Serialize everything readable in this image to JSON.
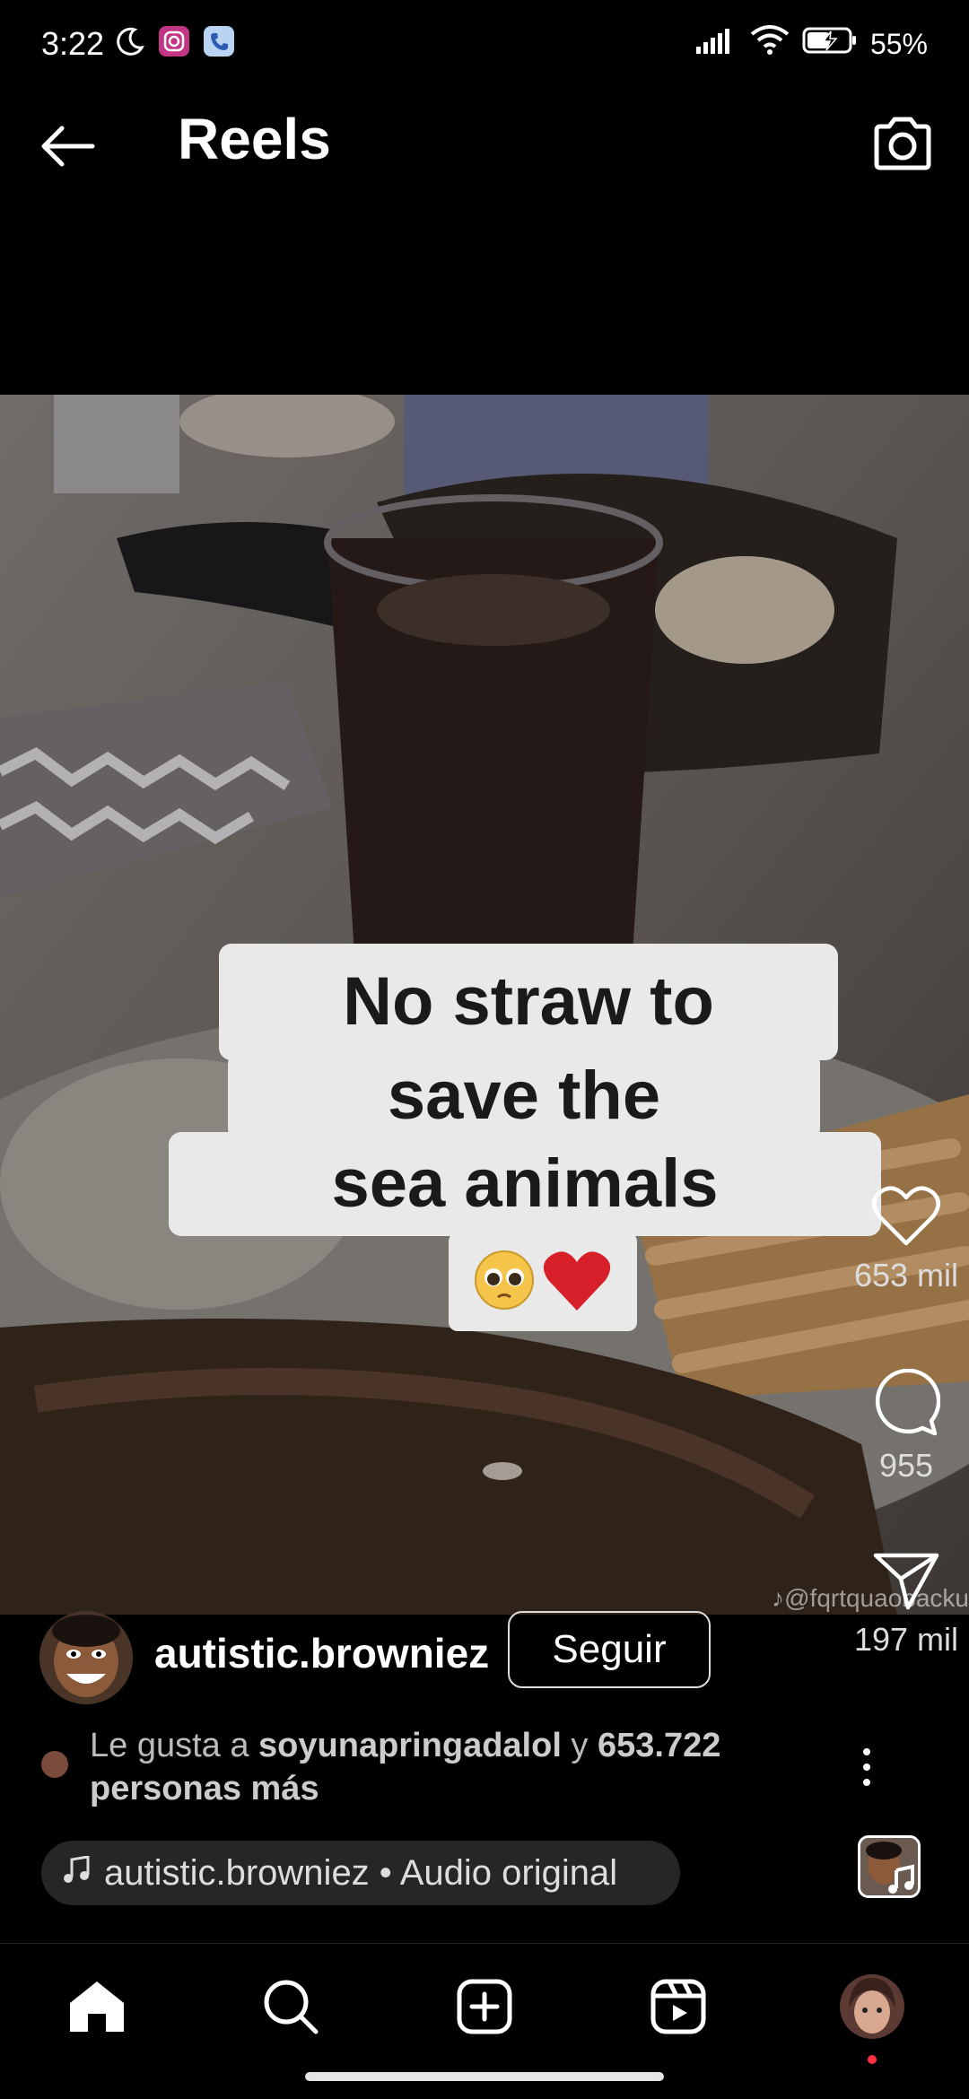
{
  "status_bar": {
    "time": "3:22",
    "battery": "55%",
    "icons": [
      "moon-icon",
      "instagram-icon",
      "phone-icon",
      "signal-icon",
      "wifi-icon",
      "battery-icon"
    ]
  },
  "header": {
    "title": "Reels",
    "back_icon": "arrow-left-icon",
    "camera_icon": "camera-icon"
  },
  "video": {
    "caption_lines": [
      "No straw to",
      "save the",
      "sea animals"
    ],
    "caption_emojis": "🥺❤️",
    "watermark": "♪@fqrtquaobacku"
  },
  "actions": {
    "likes": "653 mil",
    "comments": "955",
    "shares": "197 mil"
  },
  "user": {
    "username": "autistic.browniez",
    "follow_label": "Seguir"
  },
  "likes_info": {
    "prefix": "Le gusta a ",
    "liker": "soyunapringadalol",
    "connector": " y ",
    "count_text": "653.722 personas más"
  },
  "audio": {
    "text": "autistic.browniez • Audio original"
  },
  "bottom_nav": {
    "items": [
      "home-icon",
      "search-icon",
      "create-icon",
      "reels-icon",
      "profile-avatar"
    ]
  },
  "colors": {
    "background": "#000000",
    "notification_dot": "#ff3040",
    "pill_bg": "#262626"
  }
}
